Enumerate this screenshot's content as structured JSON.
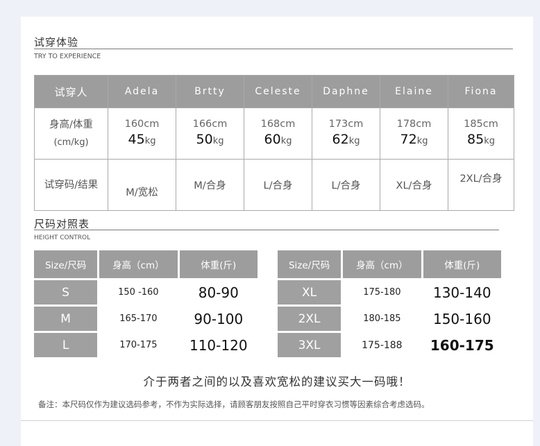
{
  "trial": {
    "title": "试穿体验",
    "subtitle": "TRY TO EXPERIENCE",
    "headers": [
      "试穿人",
      "Adela",
      "Brtty",
      "Celeste",
      "Daphne",
      "Elaine",
      "Fiona"
    ],
    "row_labels": {
      "body": "身高/体重",
      "body_unit": "(cm/kg)",
      "fit": "试穿码/结果"
    },
    "people": [
      {
        "height": "160cm",
        "weight": "45",
        "fit": "M/宽松"
      },
      {
        "height": "166cm",
        "weight": "50",
        "fit": "M/合身"
      },
      {
        "height": "168cm",
        "weight": "60",
        "fit": "L/合身"
      },
      {
        "height": "173cm",
        "weight": "62",
        "fit": "L/合身"
      },
      {
        "height": "178cm",
        "weight": "72",
        "fit": "XL/合身"
      },
      {
        "height": "185cm",
        "weight": "85",
        "fit": "2XL/合身"
      }
    ],
    "weight_unit": "kg"
  },
  "size_chart": {
    "title": "尺码对照表",
    "subtitle": "HEIGHT CONTROL",
    "headers": [
      "Size/尺码",
      "身高（cm）",
      "体重(斤)"
    ],
    "left_rows": [
      {
        "size": "S",
        "height": "150 -160",
        "weight": "80-90"
      },
      {
        "size": "M",
        "height": "165-170",
        "weight": "90-100"
      },
      {
        "size": "L",
        "height": "170-175",
        "weight": "110-120"
      }
    ],
    "right_rows": [
      {
        "size": "XL",
        "height": "175-180",
        "weight": "130-140"
      },
      {
        "size": "2XL",
        "height": "180-185",
        "weight": "150-160"
      },
      {
        "size": "3XL",
        "height": "175-188",
        "weight": "160-175"
      }
    ]
  },
  "advice": "介于两者之间的以及喜欢宽松的建议买大一码哦！",
  "note": "备注：本尺码仅作为建议选码参考，不作为实际选择，请顾客朋友按照自己平时穿衣习惯等因素综合考虑选码。"
}
